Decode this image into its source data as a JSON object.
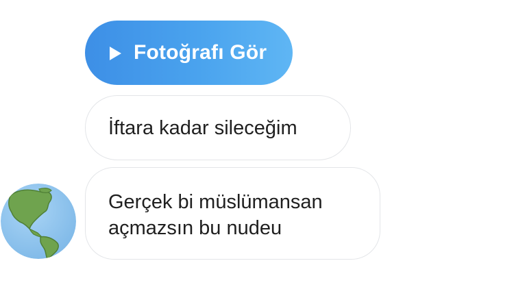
{
  "chat": {
    "photo_button": {
      "label": "Fotoğrafı Gör",
      "icon": "play-icon",
      "color": "#4aa3ee"
    },
    "messages": [
      {
        "lines": [
          "İftara kadar sileceğim"
        ]
      },
      {
        "lines": [
          "Gerçek bi müslümansan",
          "açmazsın bu nudeu"
        ]
      }
    ],
    "avatar": {
      "icon": "globe-americas-icon"
    }
  }
}
